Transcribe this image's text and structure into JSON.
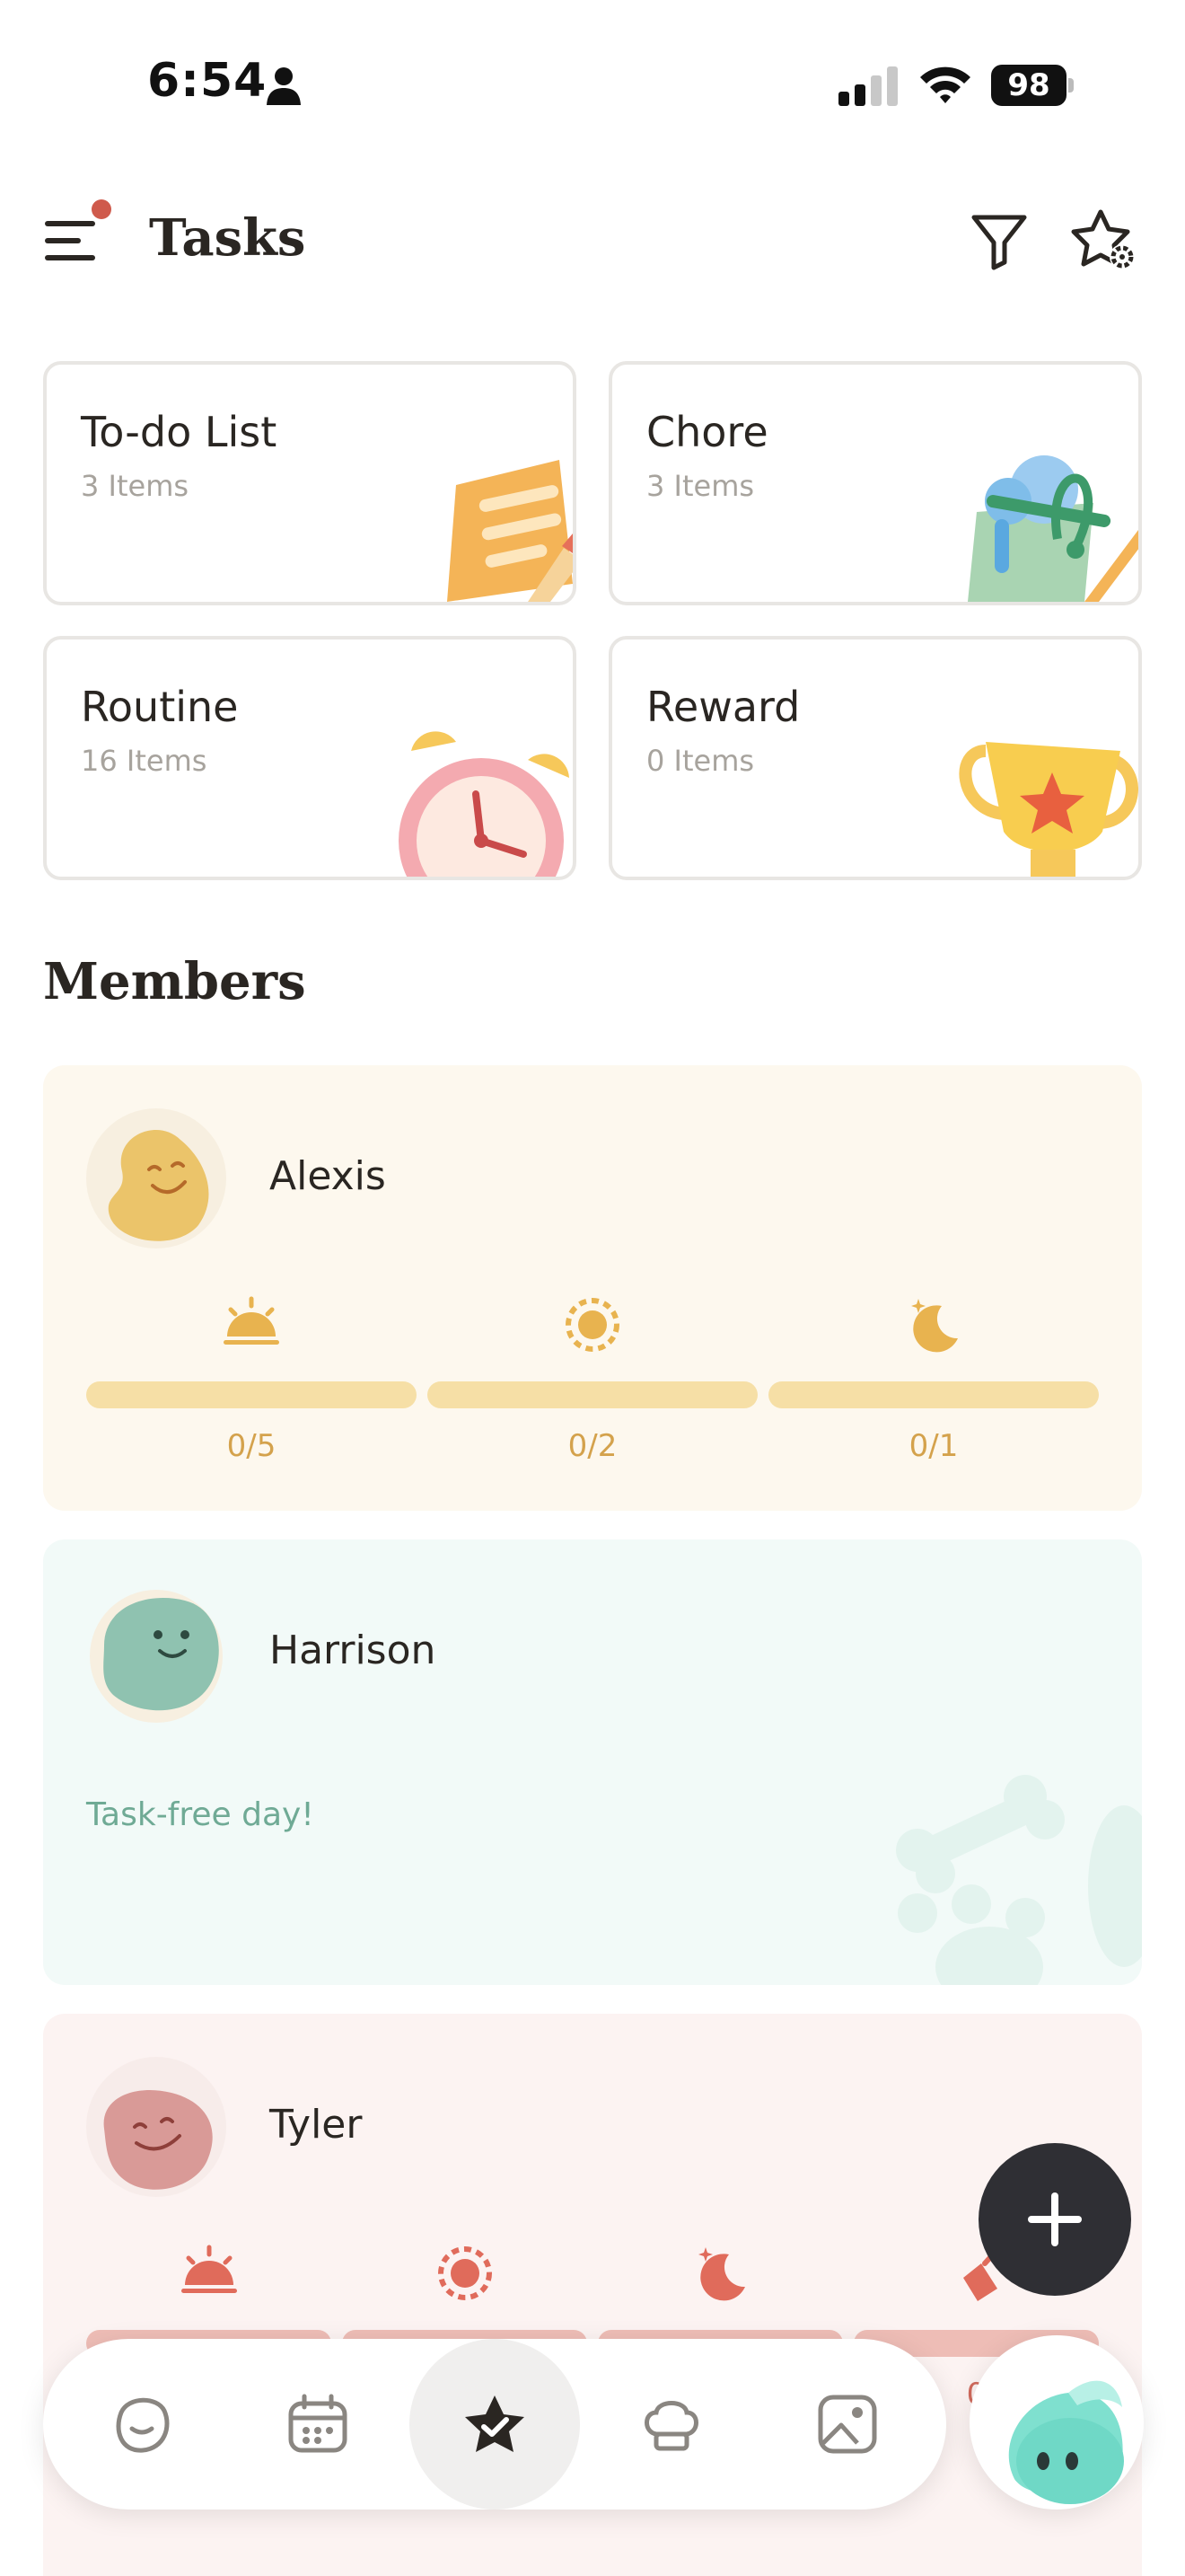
{
  "status_bar": {
    "time": "6:54",
    "battery": "98"
  },
  "header": {
    "title": "Tasks"
  },
  "categories": [
    {
      "title": "To-do List",
      "count": "3 Items",
      "icon": "notepad-illustration"
    },
    {
      "title": "Chore",
      "count": "3 Items",
      "icon": "bucket-illustration"
    },
    {
      "title": "Routine",
      "count": "16 Items",
      "icon": "alarm-clock-illustration"
    },
    {
      "title": "Reward",
      "count": "0 Items",
      "icon": "trophy-illustration"
    }
  ],
  "members_title": "Members",
  "members": [
    {
      "name": "Alexis",
      "color": "#f6dfa6",
      "periods": [
        {
          "icon": "sunrise-icon",
          "done": 0,
          "count": "0/5"
        },
        {
          "icon": "sun-icon",
          "done": 0,
          "count": "0/2"
        },
        {
          "icon": "moon-icon",
          "done": 0,
          "count": "0/1"
        }
      ]
    },
    {
      "name": "Harrison",
      "color": "#8fc2b0",
      "message": "Task-free day!"
    },
    {
      "name": "Tyler",
      "color": "#e3a09a",
      "periods": [
        {
          "icon": "sunrise-icon",
          "count": ""
        },
        {
          "icon": "sun-icon",
          "count": ""
        },
        {
          "icon": "moon-icon",
          "count": ""
        },
        {
          "icon": "broom-icon",
          "count": "0"
        }
      ]
    }
  ],
  "bottom_nav": [
    {
      "name": "home",
      "icon": "face-icon"
    },
    {
      "name": "calendar",
      "icon": "calendar-icon"
    },
    {
      "name": "tasks",
      "icon": "star-check-icon",
      "active": true
    },
    {
      "name": "meals",
      "icon": "chef-hat-icon"
    },
    {
      "name": "photos",
      "icon": "image-icon"
    }
  ],
  "colors": {
    "accent_dark": "#2f2f34",
    "notification": "#cf5a4c"
  }
}
